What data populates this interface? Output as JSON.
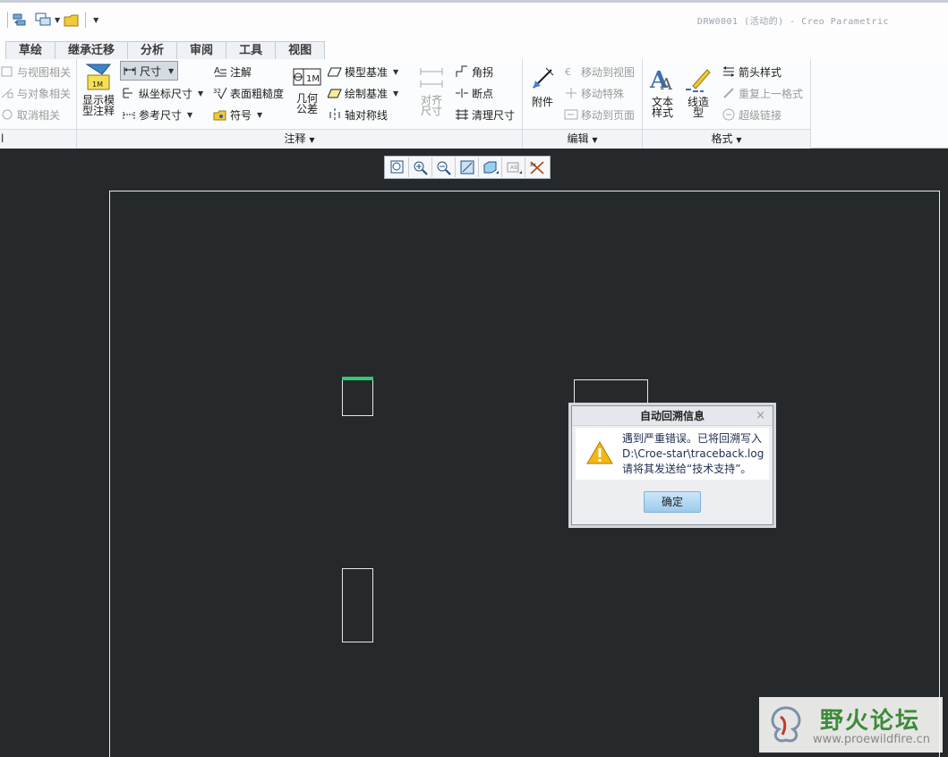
{
  "window": {
    "title": "DRW0001 (活动的) - Creo Parametric"
  },
  "tabs": [
    "草绘",
    "继承迁移",
    "分析",
    "审阅",
    "工具",
    "视图"
  ],
  "ribbon": {
    "left_group": {
      "items": [
        "与视图相关",
        "与对象相关",
        "取消相关"
      ],
      "footer": "l"
    },
    "annotation_group": {
      "footer": "注释",
      "show_model": "显示模型注释",
      "show_model_line1": "显示模",
      "show_model_line2": "型注释",
      "dimension": "尺寸",
      "ordinate": "纵坐标尺寸",
      "reference": "参考尺寸",
      "note": "注解",
      "surface_finish": "表面粗糙度",
      "symbol": "符号",
      "gtol_line1": "几何",
      "gtol_line2": "公差",
      "model_datum": "模型基准",
      "draw_datum": "绘制基准",
      "axis_sym": "轴对称线",
      "align_line1": "对齐",
      "align_line2": "尺寸",
      "jog": "角拐",
      "break": "断点",
      "cleanup": "清理尺寸"
    },
    "edit_group": {
      "footer": "编辑",
      "attach": "附件",
      "move_to_view": "移动到视图",
      "move_special": "移动特殊",
      "move_to_page": "移动到页面"
    },
    "format_group": {
      "footer": "格式",
      "text_style_line1": "文本",
      "text_style_line2": "样式",
      "line_style_line1": "线造",
      "line_style_line2": "型",
      "arrow_style": "箭头样式",
      "repeat_format": "重复上一格式",
      "hyperlink": "超级链接"
    }
  },
  "view_toolbar": [
    "refit-icon",
    "zoom-in-icon",
    "zoom-out-icon",
    "repaint-icon",
    "display-style-icon",
    "annotation-display-icon",
    "datum-display-icon"
  ],
  "dialog": {
    "title": "自动回溯信息",
    "close": "×",
    "line1": "遇到严重错误。已将回溯写入",
    "line2": "D:\\Croe-star\\traceback.log",
    "line3": "请将其发送给“技术支持”。",
    "ok": "确定"
  },
  "watermark": {
    "text": "野火论坛",
    "url": "www.proewildfire.cn"
  },
  "colors": {
    "canvas": "#25292b",
    "highlight": "#2ecc71",
    "accent_text": "#1f2d50"
  }
}
